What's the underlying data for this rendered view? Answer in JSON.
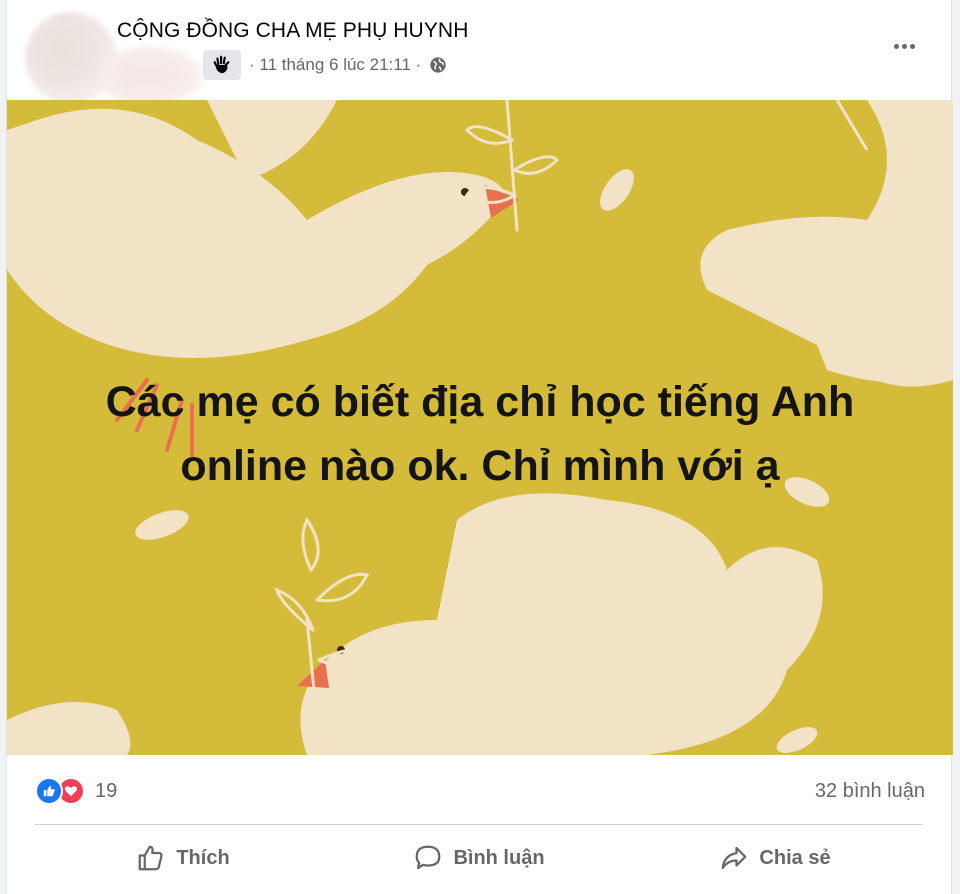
{
  "post": {
    "group_name": "CỘNG ĐỒNG CHA MẸ PHỤ HUYNH",
    "timestamp": "· 11 tháng 6 lúc 21:11 ·",
    "privacy_icon": "globe-icon",
    "badge_icon": "wave-hand-icon",
    "menu_icon": "more-horizontal-icon"
  },
  "image": {
    "background_color": "#d4bc3a",
    "text_lines": [
      "Các mẹ có biết địa chỉ học tiếng Anh",
      "online nào ok. Chỉ mình với ạ"
    ]
  },
  "reactions": {
    "icons": [
      "like-icon",
      "love-icon"
    ],
    "count": "19",
    "comments": "32 bình luận"
  },
  "actions": {
    "like": "Thích",
    "comment": "Bình luận",
    "share": "Chia sẻ"
  }
}
